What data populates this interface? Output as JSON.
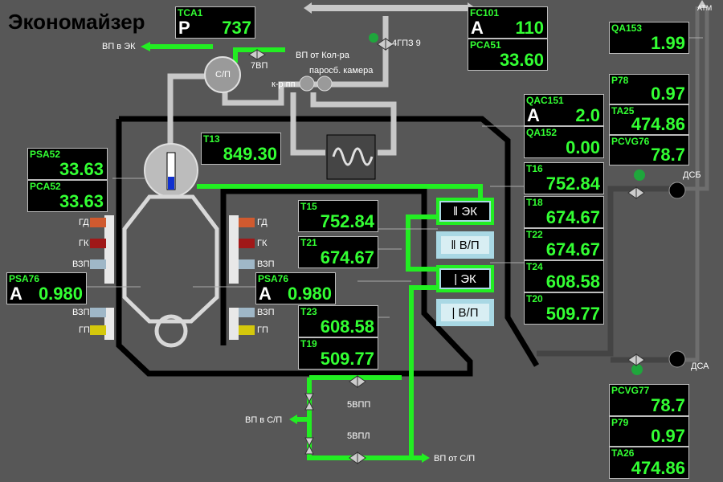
{
  "title": "Экономайзер",
  "boxes": {
    "tca1": {
      "tag": "TCA1",
      "mode": "P",
      "value": "737"
    },
    "fc101": {
      "tag": "FC101",
      "mode": "A",
      "value": "110"
    },
    "pca51": {
      "tag": "PCA51",
      "value": "33.60"
    },
    "qa153": {
      "tag": "QA153",
      "value": "1.99"
    },
    "p78": {
      "tag": "P78",
      "value": "0.97"
    },
    "ta25": {
      "tag": "TA25",
      "value": "474.86"
    },
    "pcvg76": {
      "tag": "PCVG76",
      "value": "78.7"
    },
    "qac151": {
      "tag": "QAC151",
      "mode": "A",
      "value": "2.0"
    },
    "qa152": {
      "tag": "QA152",
      "value": "0.00"
    },
    "t13": {
      "tag": "T13",
      "value": "849.30"
    },
    "psa52": {
      "tag": "PSA52",
      "value": "33.63"
    },
    "pca52": {
      "tag": "PCA52",
      "value": "33.63"
    },
    "t16": {
      "tag": "T16",
      "value": "752.84"
    },
    "t18": {
      "tag": "T18",
      "value": "674.67"
    },
    "t22": {
      "tag": "T22",
      "value": "674.67"
    },
    "t24": {
      "tag": "T24",
      "value": "608.58"
    },
    "t20": {
      "tag": "T20",
      "value": "509.77"
    },
    "t15": {
      "tag": "T15",
      "value": "752.84"
    },
    "t21": {
      "tag": "T21",
      "value": "674.67"
    },
    "t23": {
      "tag": "T23",
      "value": "608.58"
    },
    "t19": {
      "tag": "T19",
      "value": "509.77"
    },
    "psa76_left": {
      "tag": "PSA76",
      "mode": "A",
      "value": "0.980"
    },
    "psa76_right": {
      "tag": "PSA76",
      "mode": "A",
      "value": "0.980"
    },
    "pcvg77": {
      "tag": "PCVG77",
      "value": "78.7"
    },
    "p79": {
      "tag": "P79",
      "value": "0.97"
    },
    "ta26": {
      "tag": "TA26",
      "value": "474.86"
    }
  },
  "sections": {
    "ek1": "‖ ЭК",
    "vp1": "‖ В/П",
    "ek2": "| ЭК",
    "vp2": "| В/П"
  },
  "labels": {
    "vp_v_ek": "ВП в ЭК",
    "vp_ot_kolra": "ВП от Кол-ра",
    "v7": "7ВП",
    "v4gpz": "4ГПЗ 9",
    "parosb": "паросб. камера",
    "krpp": "к-р пп",
    "sp_drum": "С/П",
    "atm": "АТМ",
    "dsb": "ДСБ",
    "dsa": "ДСА",
    "gd_l": "ГД",
    "gk_l": "ГК",
    "vzp_l": "ВЗП",
    "vzp2_l": "ВЗП",
    "gp_l": "ГП",
    "gd_r": "ГД",
    "gk_r": "ГК",
    "vzp_r": "ВЗП",
    "vzp2_r": "ВЗП",
    "gp_r": "ГП",
    "v5vpp": "5ВПП",
    "v5vpl": "5ВПЛ",
    "vp_v_sp": "ВП в С/П",
    "vp_ot_sp": "ВП от С/П"
  },
  "colors": {
    "background": "#575757",
    "flow_active": "#22ee22",
    "pipe_gray": "#bdbdbd",
    "wall": "#000000",
    "value_green": "#33ff33"
  }
}
